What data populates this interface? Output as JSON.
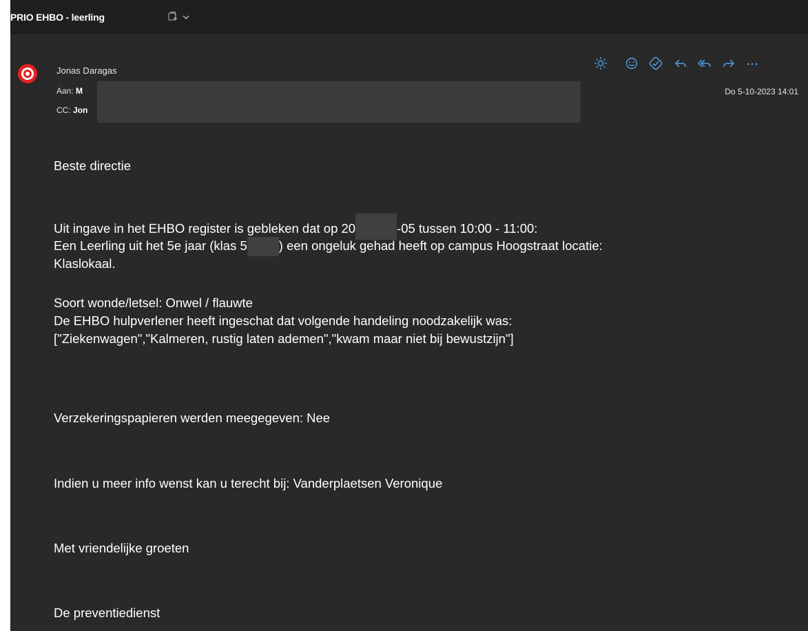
{
  "header": {
    "subject": "PRIO EHBO - leerling"
  },
  "message": {
    "sender": "Jonas Daragas",
    "to_label": "Aan:",
    "to_name": "M",
    "cc_label": "CC:",
    "cc_name": "Jon",
    "date": "Do 5-10-2023 14:01"
  },
  "actions": [
    "sun-icon",
    "emoji-icon",
    "immersive-reader-icon",
    "reply-icon",
    "reply-all-icon",
    "forward-icon",
    "more-icon"
  ],
  "body": {
    "greeting": "Beste directie",
    "line1_a": "Uit ingave in het EHBO register is gebleken dat op 20",
    "line1_b": "-05 tussen 10:00 - 11:00:",
    "line2_a": "Een Leerling uit het 5e jaar (klas 5",
    "line2_b": ") een ongeluk gehad heeft op campus Hoogstraat locatie:",
    "line3": "Klaslokaal.",
    "line4": "Soort wonde/letsel: Onwel / flauwte",
    "line5": "De EHBO hulpverlener heeft ingeschat dat volgende handeling noodzakelijk was:",
    "line6": "[\"Ziekenwagen\",\"Kalmeren, rustig laten ademen\",\"kwam maar niet bij bewustzijn\"]",
    "insurance": "Verzekeringspapieren werden meegegeven: Nee",
    "info": "Indien u meer info wenst kan u terecht bij: Vanderplaetsen Veronique",
    "closing": "Met vriendelijke groeten",
    "signature": "De preventiedienst"
  },
  "colors": {
    "background": "#292929",
    "topbar": "#1f1f1f",
    "accent": "#4f9fe8",
    "avatar": "#e62020"
  }
}
